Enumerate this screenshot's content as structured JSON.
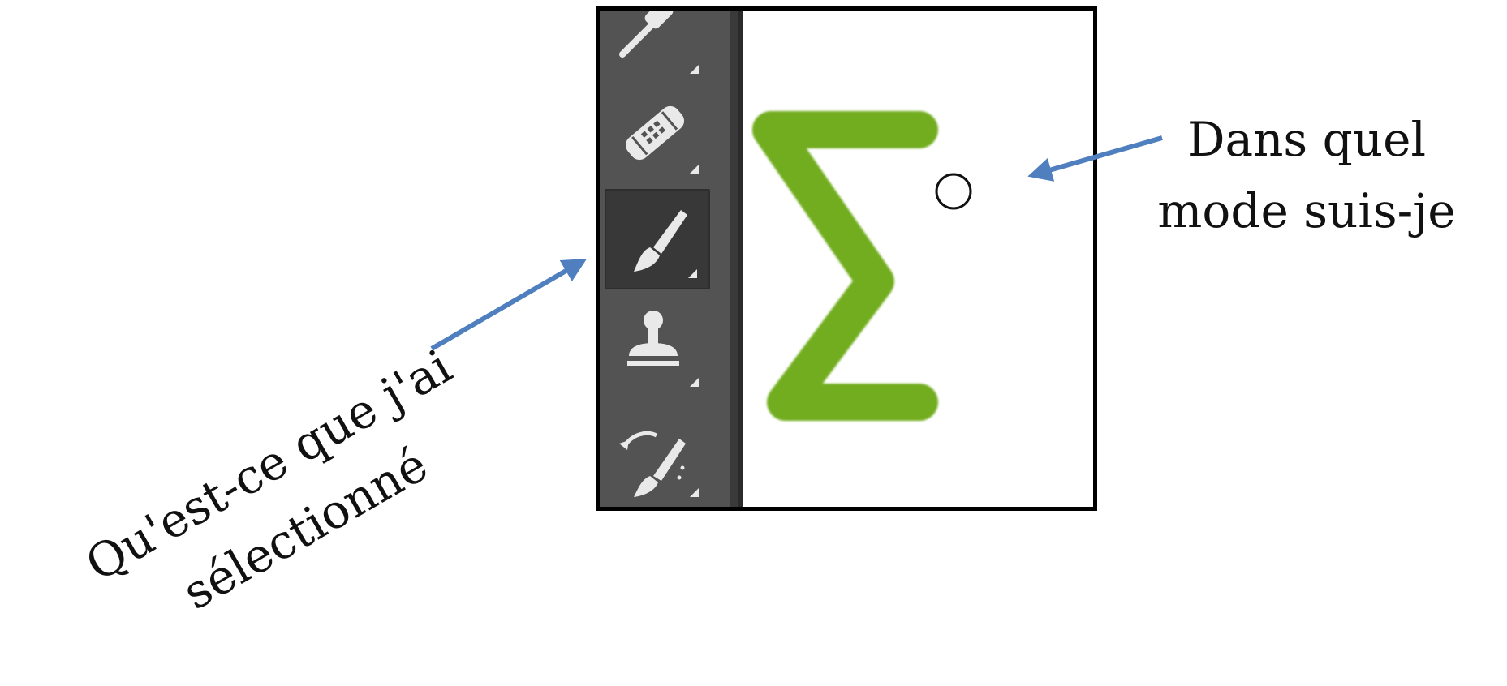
{
  "annotations": {
    "mode_question": {
      "line1": "Dans quel",
      "line2": "mode suis-je"
    },
    "selection_question": {
      "line1": "Qu'est-ce que j'ai",
      "line2": "sélectionné"
    }
  },
  "toolbar": {
    "tools": [
      {
        "icon": "eyedropper-icon",
        "selected": false
      },
      {
        "icon": "bandage-icon",
        "selected": false
      },
      {
        "icon": "brush-icon",
        "selected": true
      },
      {
        "icon": "stamp-icon",
        "selected": false
      },
      {
        "icon": "history-brush-icon",
        "selected": false
      }
    ]
  },
  "canvas": {
    "stroke_shape": "sigma",
    "cursor": "circle-brush-cursor"
  },
  "colors": {
    "toolbar_bg": "#535353",
    "selected_tool_bg": "#383838",
    "icon_color": "#e9e9e9",
    "stroke_color": "#72ad1f",
    "arrow_color": "#4f7fbf",
    "frame_border": "#000000"
  }
}
